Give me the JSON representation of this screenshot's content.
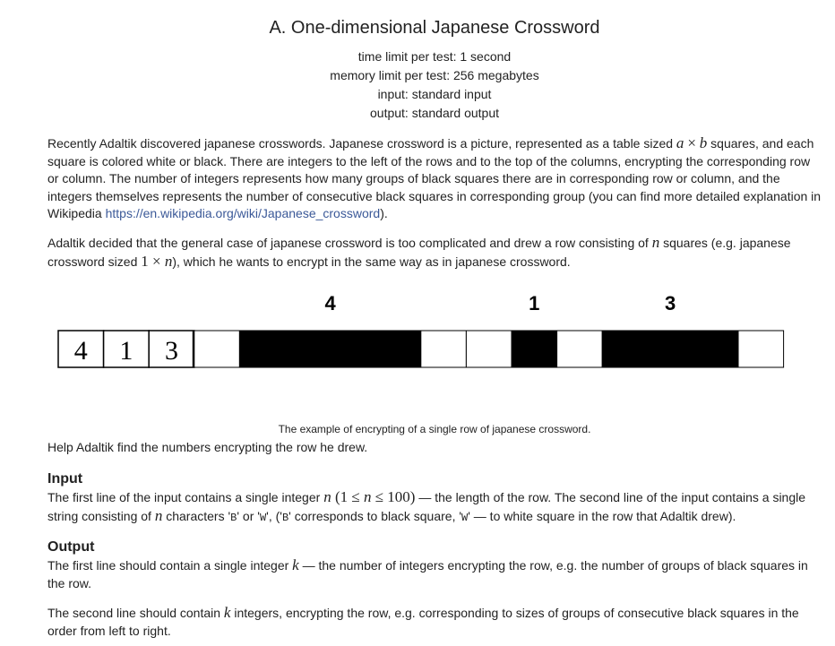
{
  "problem": {
    "title": "A. One-dimensional Japanese Crossword",
    "time_limit": "time limit per test: 1 second",
    "memory_limit": "memory limit per test: 256 megabytes",
    "input": "input: standard input",
    "output": "output: standard output"
  },
  "statement": {
    "p1_a": "Recently Adaltik discovered japanese crosswords. Japanese crossword is a picture, represented as a table sized ",
    "p1_var_a": "a",
    "p1_times": "×",
    "p1_var_b": "b",
    "p1_b": " squares, and each square is colored white or black. There are integers to the left of the rows and to the top of the columns, encrypting the corresponding row or column. The number of integers represents how many groups of black squares there are in corresponding row or column, and the integers themselves represents the number of consecutive black squares in corresponding group (you can find more detailed explanation in Wikipedia ",
    "p1_link": "https://en.wikipedia.org/wiki/Japanese_crossword",
    "p1_c": ").",
    "p2_a": "Adaltik decided that the general case of japanese crossword is too complicated and drew a row consisting of ",
    "p2_var_n": "n",
    "p2_b": " squares (e.g. japanese crossword sized ",
    "p2_one": "1",
    "p2_times": " × ",
    "p2_n": "n",
    "p2_c": "), which he wants to encrypt in the same way as in japanese crossword.",
    "caption": "The example of encrypting of a single row of japanese crossword.",
    "help": "Help Adaltik find the numbers encrypting the row he drew."
  },
  "figure": {
    "top_numbers": [
      "4",
      "1",
      "3"
    ],
    "left_numbers": [
      "4",
      "1",
      "3"
    ],
    "row": [
      "W",
      "B",
      "B",
      "B",
      "B",
      "W",
      "W",
      "B",
      "W",
      "B",
      "B",
      "B",
      "W"
    ]
  },
  "input_section": {
    "title": "Input",
    "a": "The first line of the input contains a single integer ",
    "n": "n",
    "constraint": " (1 ≤ ",
    "constraint_n": "n",
    "constraint_b": " ≤ 100)",
    "b": " — the length of the row. The second line of the input contains a single string consisting of ",
    "n2": "n",
    "c": " characters '",
    "B": "B",
    "d": "' or '",
    "W": "W",
    "e": "', ('",
    "B2": "B",
    "f": "' corresponds to black square, '",
    "W2": "W",
    "g": "' — to white square in the row that Adaltik drew)."
  },
  "output_section": {
    "title": "Output",
    "p1_a": "The first line should contain a single integer ",
    "k": "k",
    "p1_b": " — the number of integers encrypting the row, e.g. the number of groups of black squares in the row.",
    "p2_a": "The second line should contain ",
    "k2": "k",
    "p2_b": " integers, encrypting the row, e.g. corresponding to sizes of groups of consecutive black squares in the order from left to right."
  }
}
